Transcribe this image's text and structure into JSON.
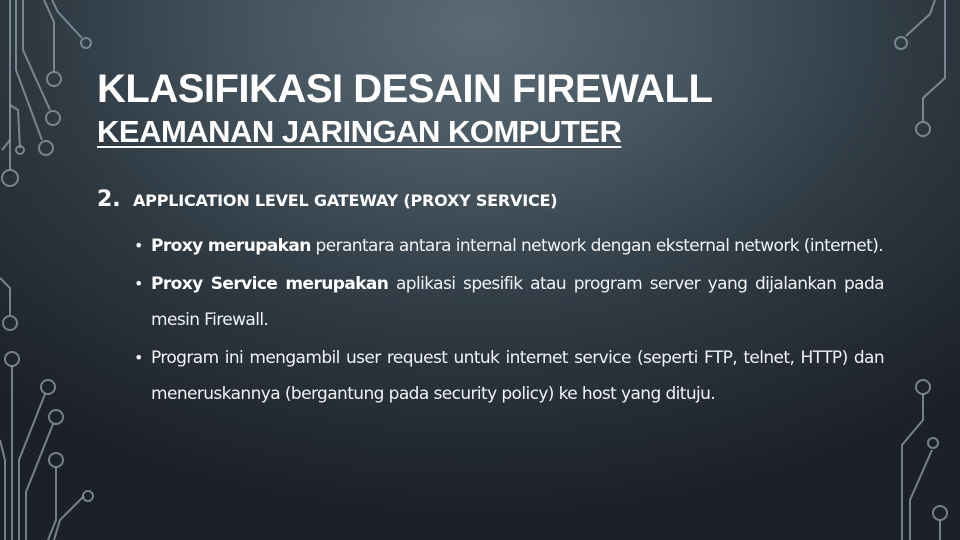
{
  "slide": {
    "title": "KLASIFIKASI DESAIN FIREWALL",
    "subtitle": "KEAMANAN JARINGAN KOMPUTER",
    "section": {
      "number": "2.",
      "heading": "APPLICATION LEVEL GATEWAY (PROXY SERVICE)"
    },
    "bullets": [
      {
        "bold": "Proxy merupakan",
        "text": " perantara antara internal network dengan eksternal network (internet)."
      },
      {
        "bold": "Proxy Service merupakan",
        "text": " aplikasi spesifik atau program server yang dijalankan pada mesin Firewall."
      },
      {
        "bold": "",
        "text": "Program ini mengambil user request untuk internet service (seperti FTP, telnet, HTTP) dan meneruskannya (bergantung pada security policy) ke host yang dituju."
      }
    ],
    "bullet_glyph": "•"
  },
  "decorations": {
    "left": "circuit-lines-icon",
    "right": "circuit-lines-icon"
  },
  "colors": {
    "background_top": "#5a6b75",
    "background_bottom": "#1c2029",
    "circuit_line": "#8c9aa3",
    "text": "#ffffff"
  }
}
